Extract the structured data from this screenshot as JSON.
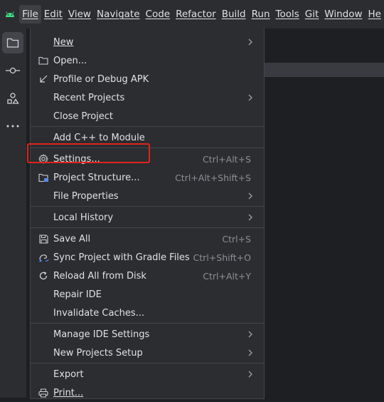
{
  "menubar": {
    "items": [
      {
        "label": "File"
      },
      {
        "label": "Edit"
      },
      {
        "label": "View"
      },
      {
        "label": "Navigate"
      },
      {
        "label": "Code"
      },
      {
        "label": "Refactor"
      },
      {
        "label": "Build"
      },
      {
        "label": "Run"
      },
      {
        "label": "Tools"
      },
      {
        "label": "Git"
      },
      {
        "label": "Window"
      },
      {
        "label": "He"
      }
    ]
  },
  "sidebar": {
    "icons": [
      "folder-icon",
      "commit-icon",
      "structure-icon",
      "more-icon"
    ]
  },
  "file_menu": {
    "new": {
      "label": "New"
    },
    "open": {
      "label": "Open..."
    },
    "profile_debug_apk": {
      "label": "Profile or Debug APK"
    },
    "recent_projects": {
      "label": "Recent Projects"
    },
    "close_project": {
      "label": "Close Project"
    },
    "add_cpp_module": {
      "label": "Add C++ to Module"
    },
    "settings": {
      "label": "Settings...",
      "shortcut": "Ctrl+Alt+S"
    },
    "project_structure": {
      "label": "Project Structure...",
      "shortcut": "Ctrl+Alt+Shift+S"
    },
    "file_properties": {
      "label": "File Properties"
    },
    "local_history": {
      "label": "Local History"
    },
    "save_all": {
      "label": "Save All",
      "shortcut": "Ctrl+S"
    },
    "sync_gradle": {
      "label": "Sync Project with Gradle Files",
      "shortcut": "Ctrl+Shift+O"
    },
    "reload_disk": {
      "label": "Reload All from Disk",
      "shortcut": "Ctrl+Alt+Y"
    },
    "repair_ide": {
      "label": "Repair IDE"
    },
    "invalidate_caches": {
      "label": "Invalidate Caches..."
    },
    "manage_ide_settings": {
      "label": "Manage IDE Settings"
    },
    "new_projects_setup": {
      "label": "New Projects Setup"
    },
    "export": {
      "label": "Export"
    },
    "print": {
      "label": "Print..."
    }
  },
  "colors": {
    "menu_bg": "#2b2d30",
    "editor_bg": "#1e1f22",
    "highlight_red": "#e0241c",
    "android_green": "#3ddc84"
  }
}
